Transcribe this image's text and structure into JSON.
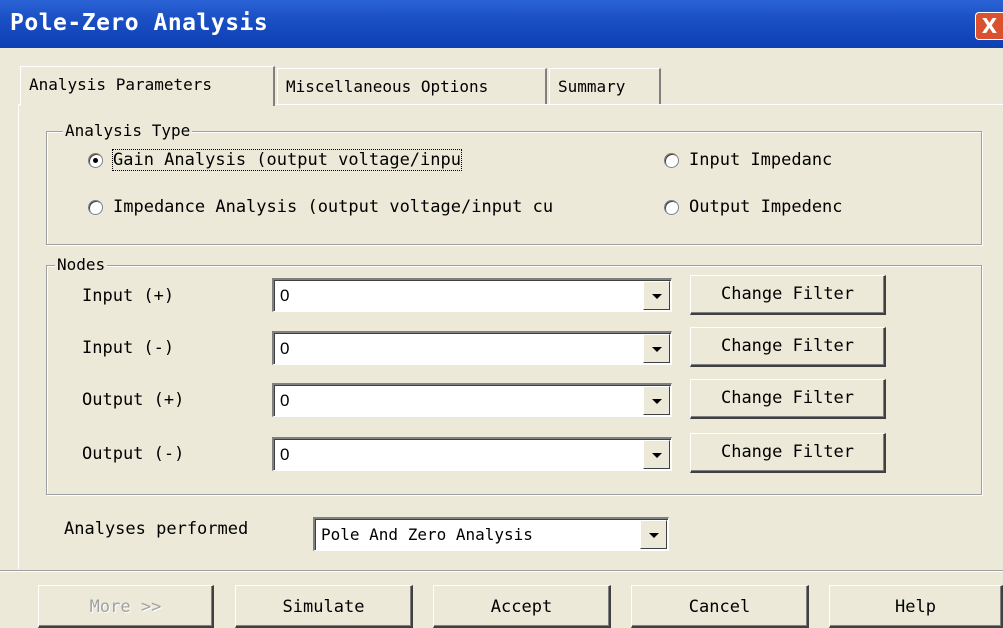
{
  "window": {
    "title": "Pole-Zero Analysis",
    "close_glyph": "X"
  },
  "tabs": [
    {
      "label": "Analysis Parameters",
      "active": true
    },
    {
      "label": "Miscellaneous Options",
      "active": false
    },
    {
      "label": "Summary",
      "active": false
    }
  ],
  "analysis_type": {
    "title": "Analysis Type",
    "options": [
      {
        "label": "Gain Analysis (output voltage/inpu",
        "checked": true
      },
      {
        "label": "Input Impedanc",
        "checked": false
      },
      {
        "label": "Impedance Analysis (output voltage/input cu",
        "checked": false
      },
      {
        "label": "Output Impedenc",
        "checked": false
      }
    ]
  },
  "nodes": {
    "title": "Nodes",
    "rows": [
      {
        "label": "Input (+)",
        "value": "0",
        "button": "Change Filter"
      },
      {
        "label": "Input (-)",
        "value": "0",
        "button": "Change Filter"
      },
      {
        "label": "Output (+)",
        "value": "0",
        "button": "Change Filter"
      },
      {
        "label": "Output (-)",
        "value": "0",
        "button": "Change Filter"
      }
    ]
  },
  "analyses_performed": {
    "label": "Analyses performed",
    "value": "Pole And Zero Analysis"
  },
  "buttons": {
    "more": "More >>",
    "simulate": "Simulate",
    "accept": "Accept",
    "cancel": "Cancel",
    "help": "Help"
  }
}
